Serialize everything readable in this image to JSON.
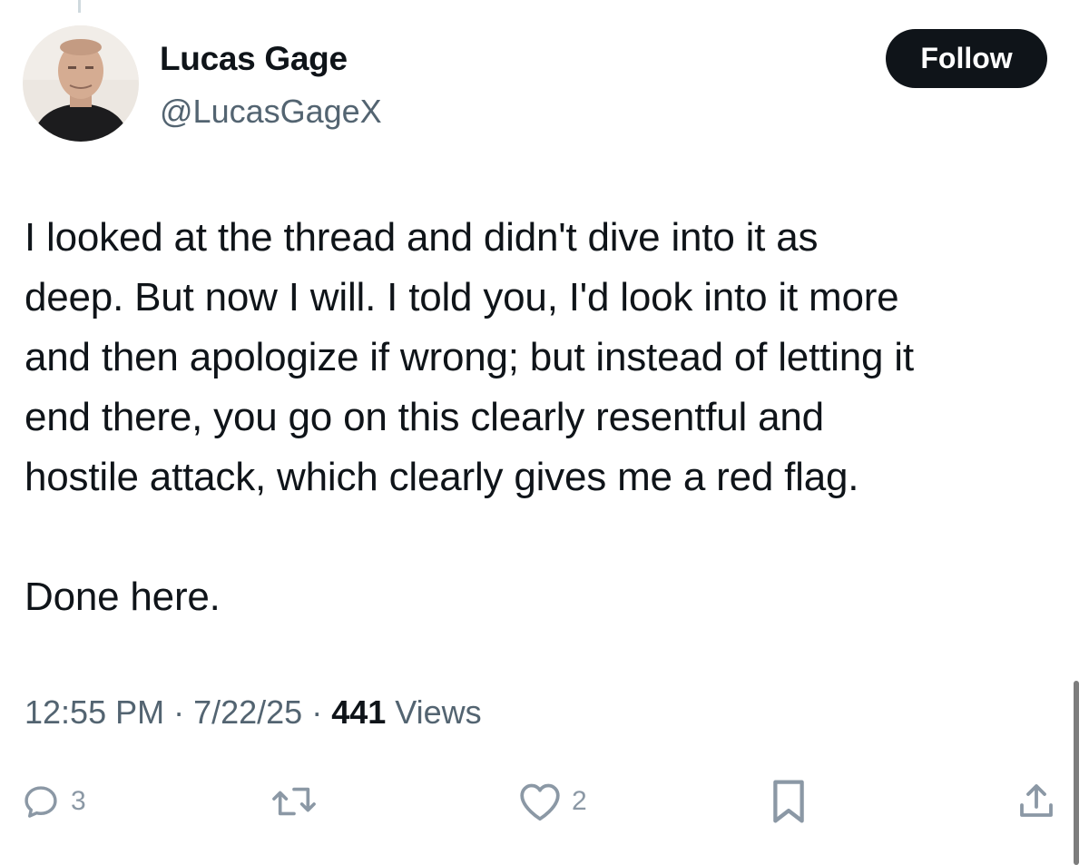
{
  "author": {
    "display_name": "Lucas Gage",
    "handle": "@LucasGageX"
  },
  "follow_label": "Follow",
  "tweet": {
    "lines": [
      "I looked at the thread and didn't dive into it as",
      "deep. But now I will. I told you, I'd look into it more",
      "and then apologize if wrong; but instead of letting it",
      "end there, you go on this clearly resentful and",
      "hostile attack, which clearly gives me a red flag."
    ],
    "closing": "Done here."
  },
  "meta": {
    "time": "12:55 PM",
    "separator": " · ",
    "date": "7/22/25",
    "views_count": "441",
    "views_label": " Views"
  },
  "actions": {
    "reply": {
      "icon": "reply-icon",
      "count": "3"
    },
    "retweet": {
      "icon": "retweet-icon",
      "count": ""
    },
    "like": {
      "icon": "heart-icon",
      "count": "2"
    },
    "bookmark": {
      "icon": "bookmark-icon"
    },
    "share": {
      "icon": "share-icon"
    }
  },
  "colors": {
    "text_primary": "#0f1419",
    "text_secondary": "#536471",
    "action_icon": "#8b98a5",
    "follow_bg": "#0f1419"
  }
}
